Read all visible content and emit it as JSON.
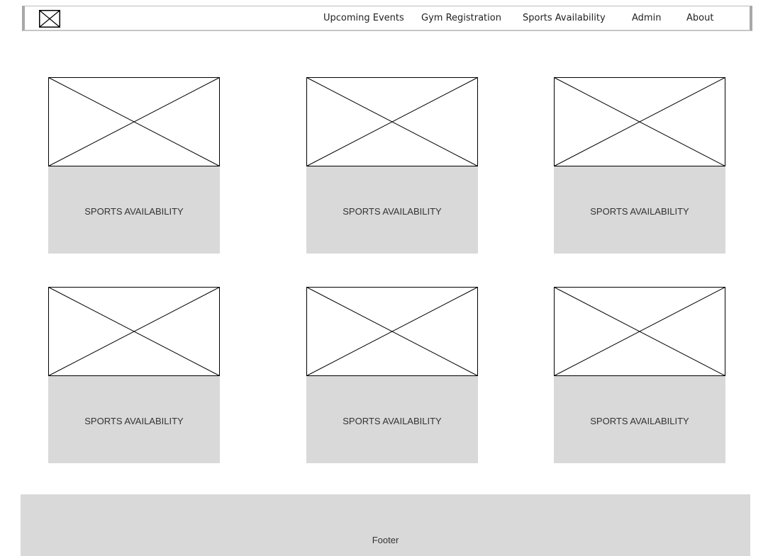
{
  "nav": {
    "items": [
      {
        "label": "Upcoming Events"
      },
      {
        "label": "Gym Registration"
      },
      {
        "label": "Sports Availability"
      },
      {
        "label": "Admin"
      },
      {
        "label": "About"
      }
    ]
  },
  "cards": [
    {
      "label": "SPORTS AVAILABILITY"
    },
    {
      "label": "SPORTS AVAILABILITY"
    },
    {
      "label": "SPORTS AVAILABILITY"
    },
    {
      "label": "SPORTS AVAILABILITY"
    },
    {
      "label": "SPORTS AVAILABILITY"
    },
    {
      "label": "SPORTS AVAILABILITY"
    }
  ],
  "footer": {
    "label": "Footer"
  },
  "colors": {
    "card_body": "#d9d9d9",
    "footer": "#d9d9d9",
    "placeholder_stroke": "#000000"
  }
}
